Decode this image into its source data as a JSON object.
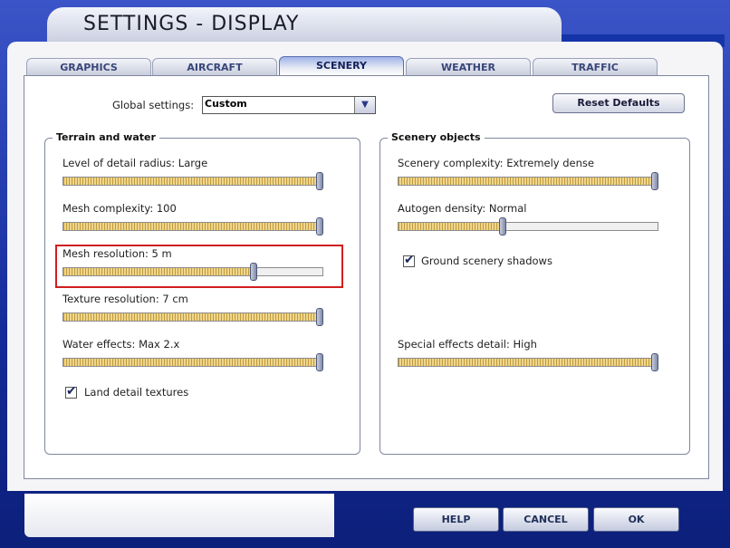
{
  "window": {
    "title": "SETTINGS - DISPLAY"
  },
  "tabs": [
    {
      "label": "GRAPHICS"
    },
    {
      "label": "AIRCRAFT"
    },
    {
      "label": "SCENERY"
    },
    {
      "label": "WEATHER"
    },
    {
      "label": "TRAFFIC"
    }
  ],
  "active_tab": "SCENERY",
  "global": {
    "label": "Global settings:",
    "value": "Custom"
  },
  "reset_label": "Reset Defaults",
  "terrain": {
    "title": "Terrain and water",
    "sliders": [
      {
        "label": "Level of detail radius: Large",
        "value": 1.0
      },
      {
        "label": "Mesh complexity: 100",
        "value": 1.0
      },
      {
        "label": "Mesh resolution: 5 m",
        "value": 0.74
      },
      {
        "label": "Texture resolution: 7 cm",
        "value": 1.0
      },
      {
        "label": "Water effects: Max 2.x",
        "value": 1.0
      }
    ],
    "checkbox": {
      "label": "Land detail textures",
      "checked": true
    }
  },
  "scenery": {
    "title": "Scenery objects",
    "sliders": [
      {
        "label": "Scenery complexity: Extremely dense",
        "value": 1.0
      },
      {
        "label": "Autogen density: Normal",
        "value": 0.4
      },
      {
        "label": "Special effects detail: High",
        "value": 1.0
      }
    ],
    "checkbox": {
      "label": "Ground scenery shadows",
      "checked": true
    }
  },
  "buttons": {
    "help": "HELP",
    "cancel": "CANCEL",
    "ok": "OK"
  },
  "icons": {
    "dropdown": "chevron-down-icon",
    "check": "checkmark-icon"
  },
  "colors": {
    "accent": "#1534a8",
    "highlight": "#d21e1e",
    "fill": "#c29a3a"
  }
}
